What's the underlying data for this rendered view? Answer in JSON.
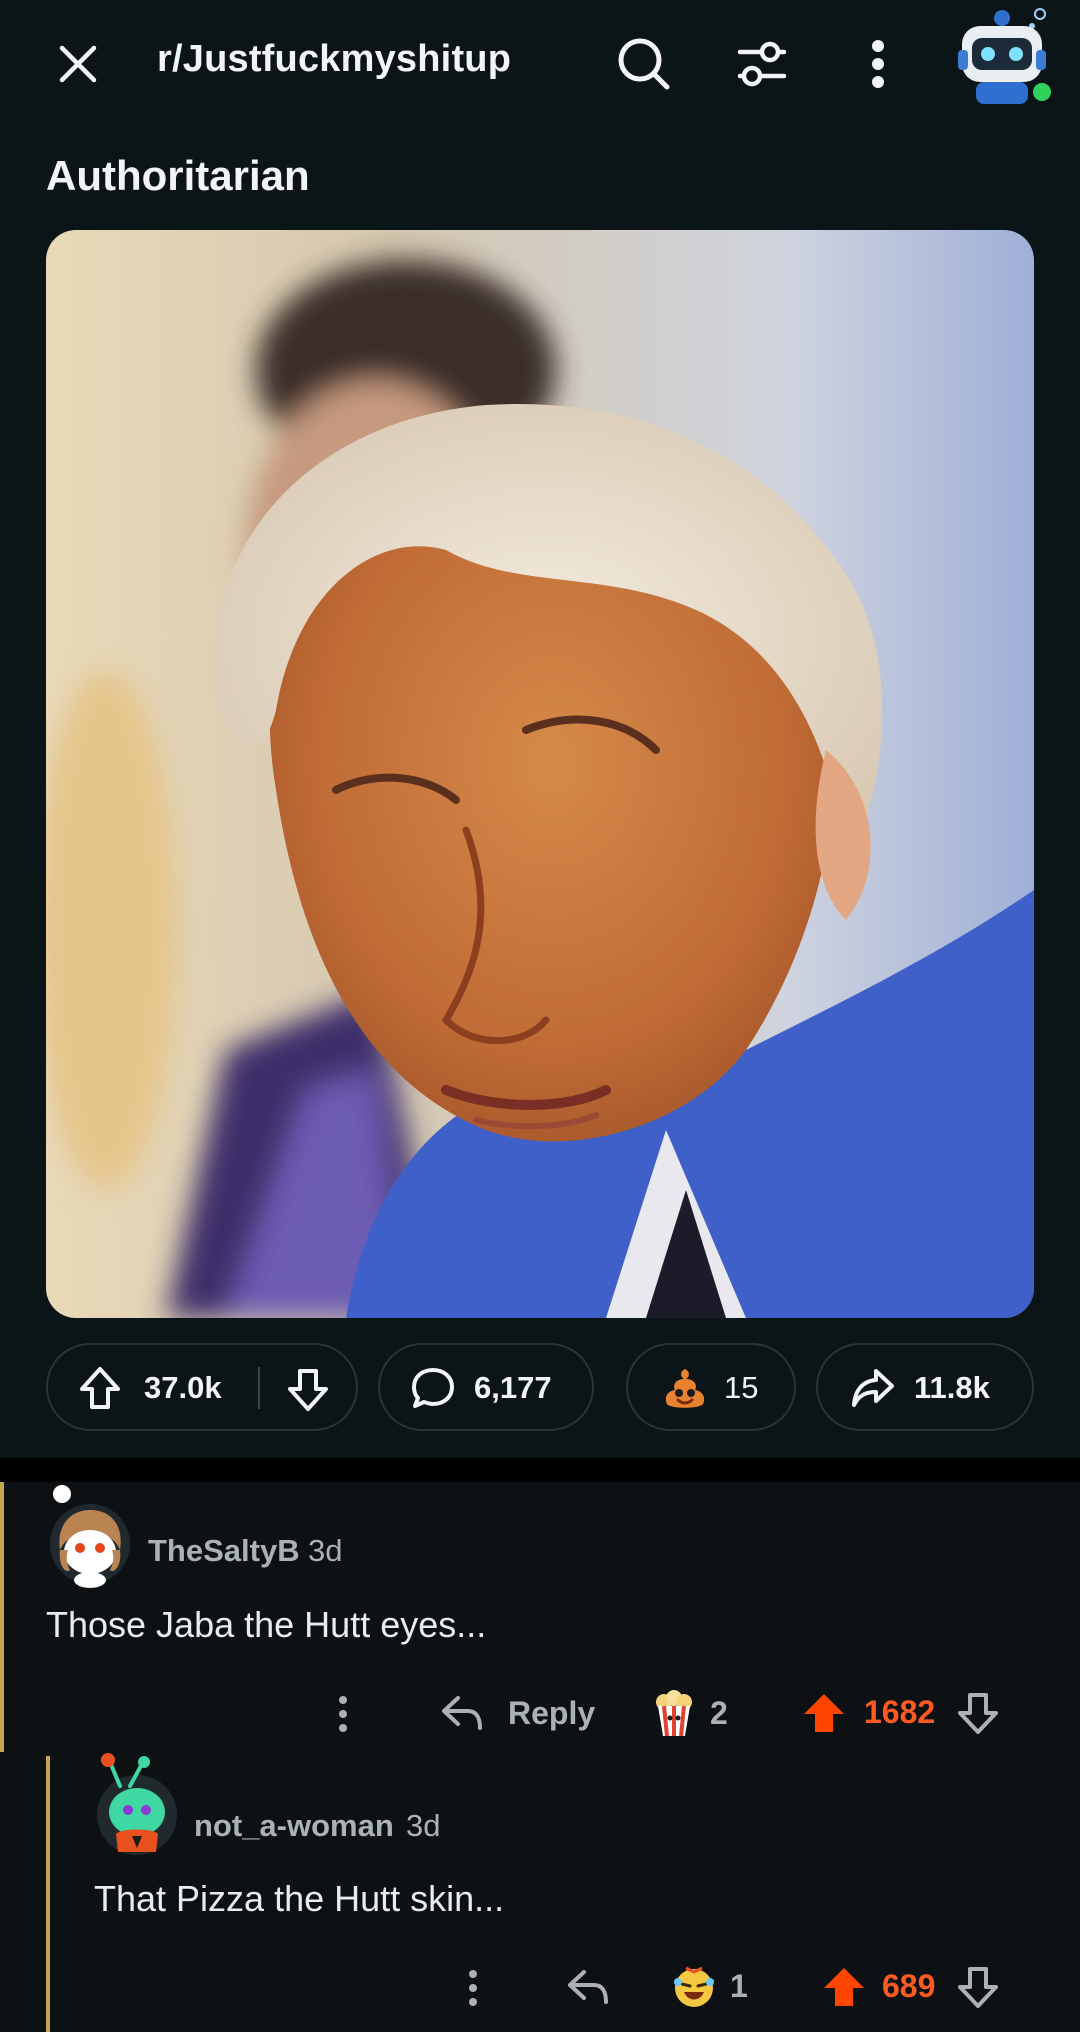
{
  "topbar": {
    "subreddit": "r/Justfuckmyshitup",
    "icons": [
      "close-icon",
      "search-icon",
      "filter-icon",
      "more-vertical-icon",
      "user-avatar"
    ]
  },
  "post": {
    "title": "Authoritarian",
    "media_alt": "",
    "actions": {
      "upvotes": "37.0k",
      "comments": "6,177",
      "award_count": "15",
      "shares": "11.8k"
    }
  },
  "comments": [
    {
      "username": "TheSaltyB",
      "age": "3d",
      "text": "Those Jaba the Hutt eyes...",
      "reply_label": "Reply",
      "award_count": "2",
      "score": "1682"
    },
    {
      "username": "not_a-woman",
      "age": "3d",
      "text": "That Pizza the Hutt skin...",
      "award_count": "1",
      "score": "689"
    }
  ],
  "colors": {
    "background": "#0b1416",
    "thread_line": "#c3a74a",
    "upvote_active": "#ff4500",
    "score_active": "#ff5a21"
  }
}
